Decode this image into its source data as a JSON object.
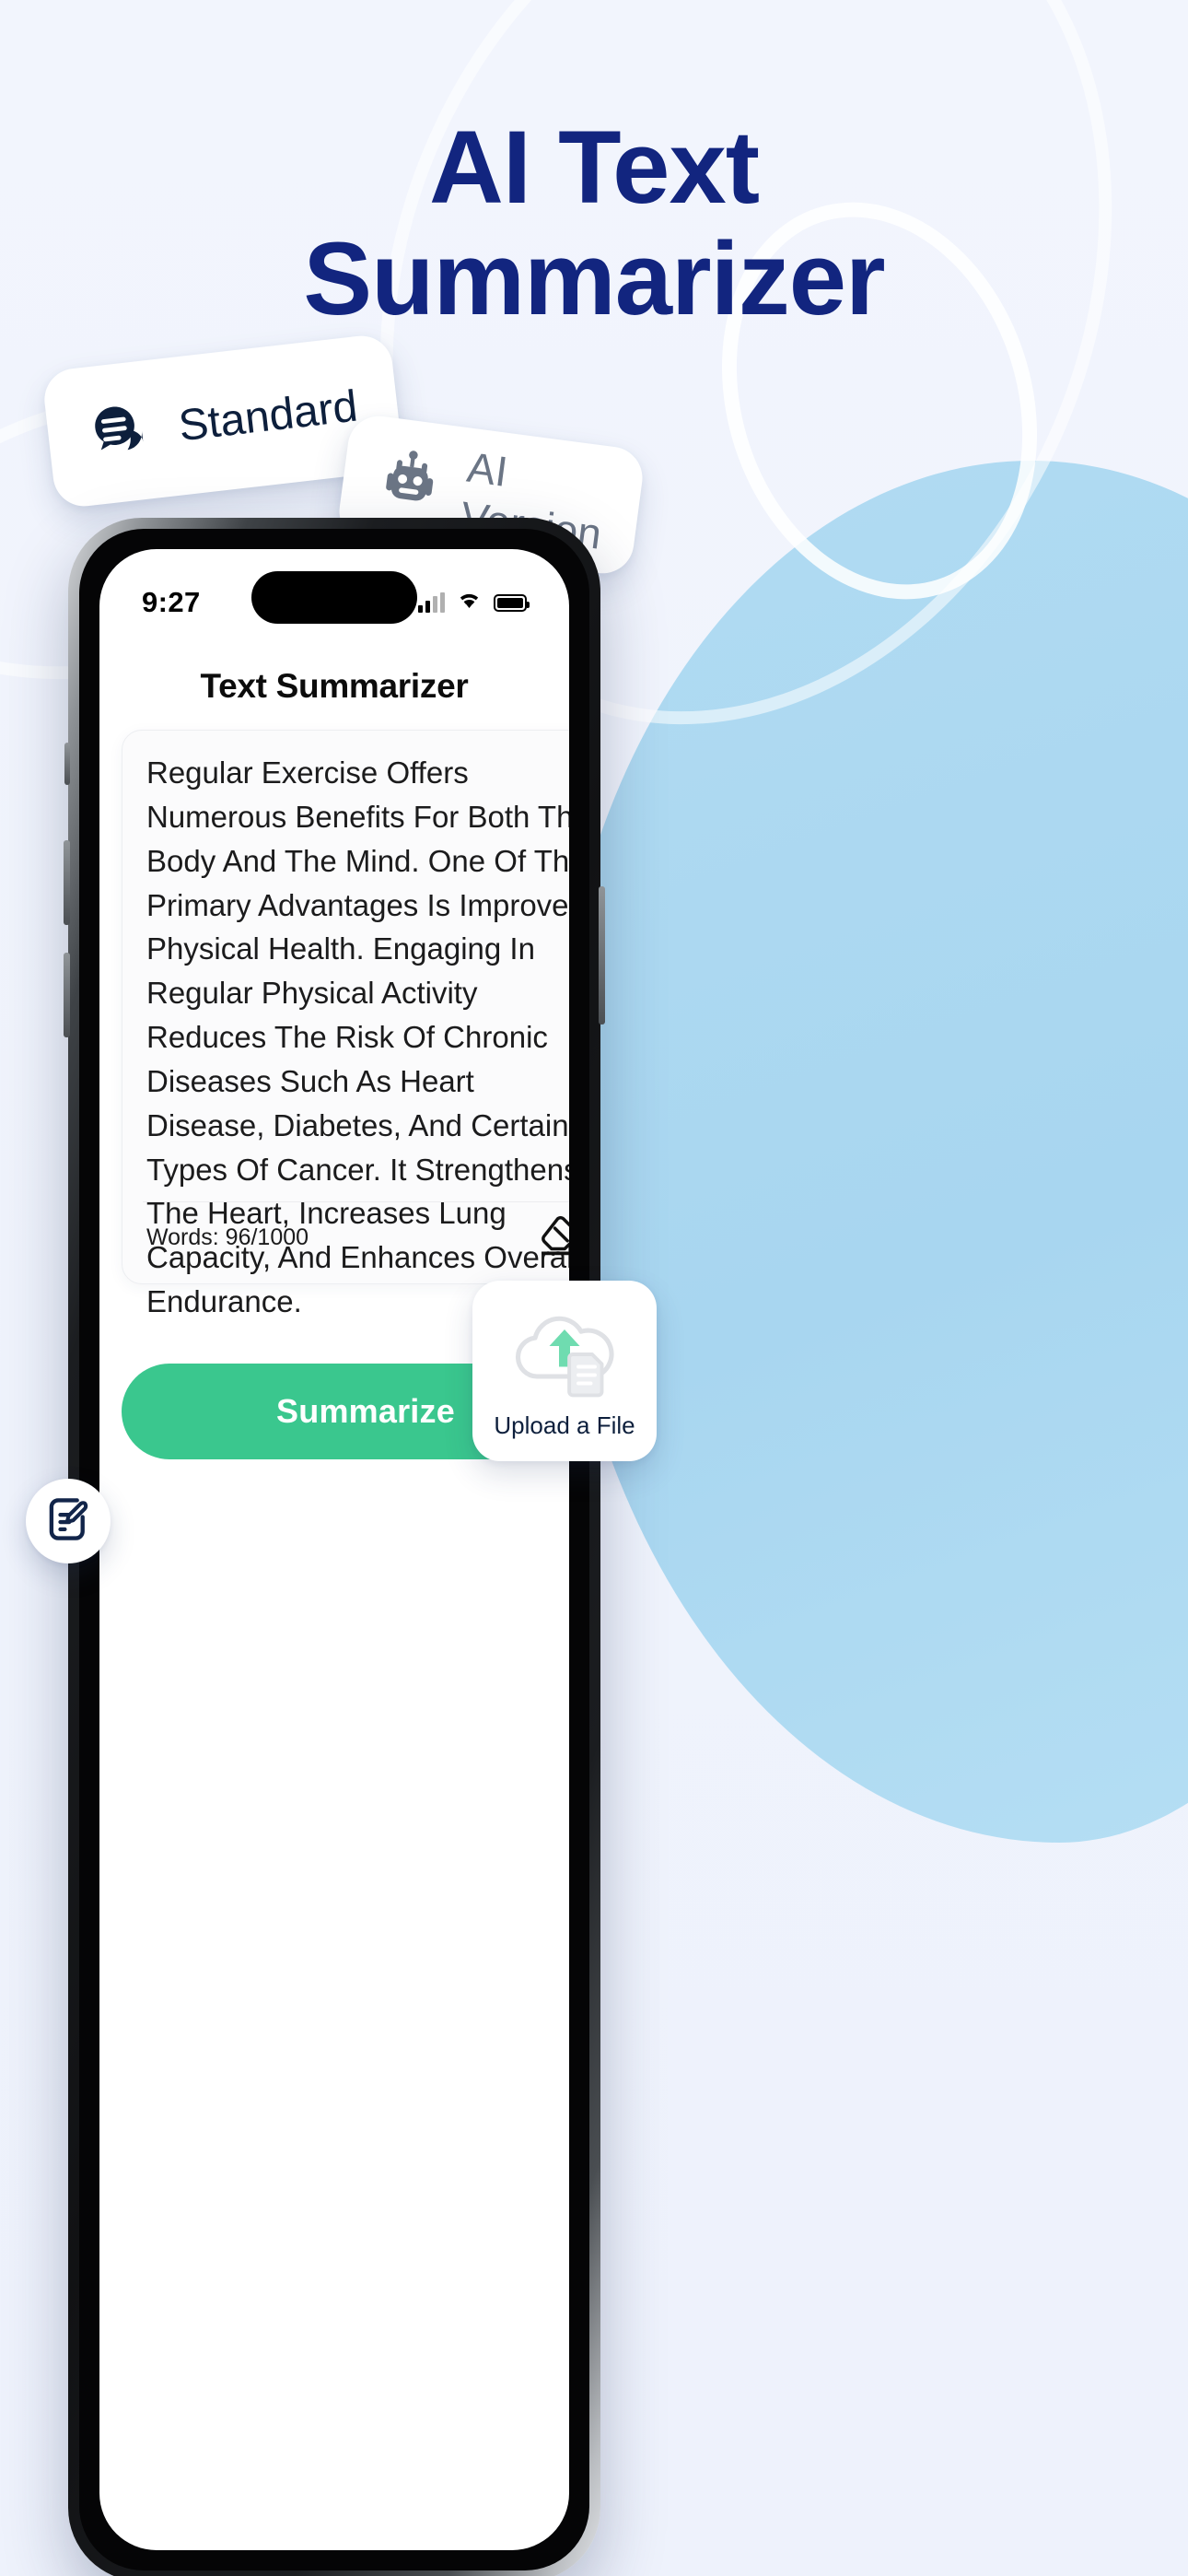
{
  "hero": {
    "title": "AI Text\nSummarizer",
    "title_color": "#12257f"
  },
  "background": {
    "base_color": "#f1f4fd",
    "blob_color": "#abd8f1"
  },
  "badges": [
    {
      "label": "Standard",
      "icon": "chat-bubble-lines-icon",
      "text_color": "#0d1f3c"
    },
    {
      "label": "AI Version",
      "icon": "robot-icon",
      "text_color": "#6b7585"
    }
  ],
  "phone": {
    "status_bar": {
      "time": "9:27",
      "icons": [
        "cellular-signal-icon",
        "wifi-icon",
        "battery-icon"
      ]
    },
    "app": {
      "title": "Text Summarizer",
      "editor": {
        "content": "Regular Exercise Offers Numerous Benefits For Both The Body And The Mind. One Of The Primary Advantages Is Improved Physical Health. Engaging In Regular Physical Activity Reduces The Risk Of Chronic Diseases Such As Heart Disease, Diabetes, And Certain Types Of Cancer. It Strengthens The Heart, Increases Lung Capacity, And Enhances Overall Endurance.",
        "word_count_label": "Words: 96/1000",
        "clear_icon": "eraser-icon"
      },
      "primary_button": {
        "label": "Summarize",
        "color": "#3ac78e",
        "text_color": "#ffffff"
      }
    }
  },
  "overlays": {
    "upload": {
      "label": "Upload a File",
      "icon": "cloud-upload-document-icon",
      "accent_color": "#6fdcb0"
    },
    "doc_edit": {
      "icon": "document-edit-icon",
      "icon_color": "#12254a"
    }
  }
}
